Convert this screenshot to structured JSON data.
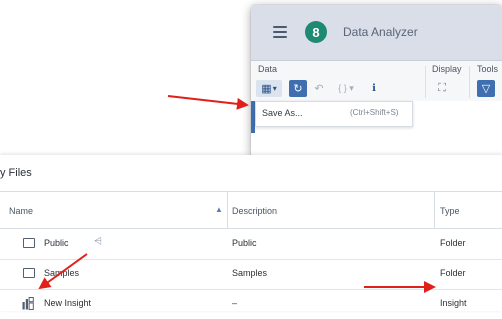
{
  "toolbar": {
    "app_title": "Data Analyzer",
    "avatar_letter": "8",
    "groups": {
      "data": "Data",
      "display": "Display",
      "tools": "Tools"
    },
    "buttons": {
      "save_icon": "▦",
      "save_chevron": "▾",
      "refresh_icon": "↻",
      "undo_icon": "↶",
      "braces_icon": "{ } ▾",
      "info_icon": "ℹ",
      "expand_icon": "⛶",
      "filter_icon": "▽"
    },
    "save_menu": {
      "label": "Save As...",
      "shortcut": "(Ctrl+Shift+S)"
    }
  },
  "files": {
    "title": "y Files",
    "columns": {
      "name": "Name",
      "description": "Description",
      "type": "Type"
    },
    "sort_icon": "▲",
    "rows": [
      {
        "name": "Public",
        "description": "Public",
        "type": "Folder",
        "icon": "folder-icon"
      },
      {
        "name": "Samples",
        "description": "Samples",
        "type": "Folder",
        "icon": "folder-icon"
      },
      {
        "name": "New Insight",
        "description": "–",
        "type": "Insight",
        "icon": "insight-icon"
      }
    ]
  },
  "colors": {
    "accent": "#3f6fb0",
    "avatar": "#1f8a73",
    "annotation": "#e0201b"
  }
}
